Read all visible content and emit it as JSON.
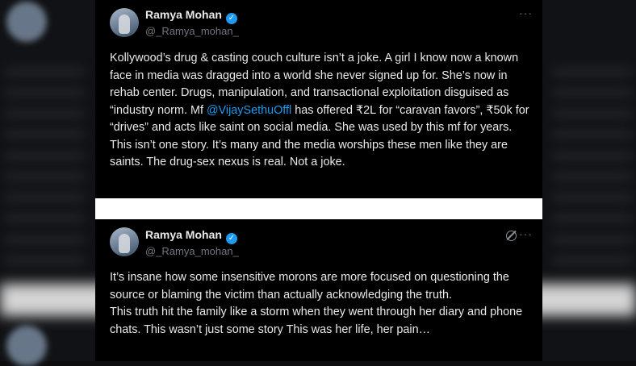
{
  "tweets": [
    {
      "name": "Ramya Mohan",
      "handle": "@_Ramya_mohan_",
      "text_before_mention": "Kollywood’s drug & casting couch culture isn’t a joke. A girl I know now a known face in media was dragged into a world she never signed up for. She’s now in  rehab center. Drugs, manipulation, and transactional exploitation disguised as “industry norm. Mf ",
      "mention": "@VijaySethuOffl",
      "text_after_mention": " has offered ₹2L for “caravan favors”, ₹50k for “drives” and acts like saint on social media. She was used by this mf for years. This isn’t one story. It’s many and the media worships these men like they are saints. The drug-sex nexus is real. Not a joke."
    },
    {
      "name": "Ramya Mohan",
      "handle": "@_Ramya_mohan_",
      "text": "It’s insane how some insensitive morons are more focused on questioning the source or blaming the victim than actually acknowledging the truth.\nThis truth hit the family like a storm when they went through her diary and phone chats. This wasn’t just some story This was her life, her pain…"
    }
  ],
  "icons": {
    "more": "more-options-icon",
    "verified": "verified-badge-icon",
    "grok": "grok-icon"
  },
  "colors": {
    "background": "#000000",
    "text": "#e7e9ea",
    "secondary": "#71767b",
    "accent": "#1d9bf0"
  }
}
